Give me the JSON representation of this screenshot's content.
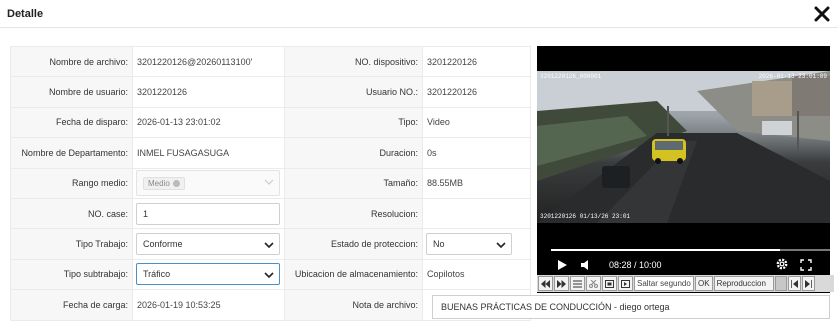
{
  "dialog": {
    "title": "Detalle",
    "close_icon": "close-x-icon"
  },
  "form": {
    "nombre_archivo": {
      "label": "Nombre de archivo:",
      "value": "3201220126@20260113100'"
    },
    "no_dispositivo": {
      "label": "NO. dispositivo:",
      "value": "3201220126"
    },
    "nombre_usuario": {
      "label": "Nombre de usuario:",
      "value": "3201220126"
    },
    "usuario_no": {
      "label": "Usuario NO.:",
      "value": "3201220126"
    },
    "fecha_disparo": {
      "label": "Fecha de disparo:",
      "value": "2026-01-13 23:01:02"
    },
    "tipo": {
      "label": "Tipo:",
      "value": "Video"
    },
    "departamento": {
      "label": "Nombre de Departamento:",
      "value": "INMEL FUSAGASUGA"
    },
    "duracion": {
      "label": "Duracion:",
      "value": "0s"
    },
    "rango_medio": {
      "label": "Rango medio:",
      "tag": "Medio"
    },
    "tamano": {
      "label": "Tamaño:",
      "value": "88.55MB"
    },
    "no_case": {
      "label": "NO. case:",
      "value": "1"
    },
    "resolucion": {
      "label": "Resolucion:",
      "value": ""
    },
    "tipo_trabajo": {
      "label": "Tipo Trabajo:",
      "value": "Conforme"
    },
    "estado_proteccion": {
      "label": "Estado de proteccion:",
      "value": "No"
    },
    "tipo_subtrabajo": {
      "label": "Tipo subtrabajo:",
      "value": "Tráfico"
    },
    "ubicacion": {
      "label": "Ubicacion de almacenamiento:",
      "value": "Copilotos"
    },
    "fecha_carga": {
      "label": "Fecha de carga:",
      "value": "2026-01-19 10:53:25"
    },
    "nota_archivo": {
      "label": "Nota de archivo:",
      "value": "BUENAS PRÁCTICAS DE CONDUCCIÓN - diego ortega"
    }
  },
  "player": {
    "osd_top_left": "3201220126_000001",
    "osd_top_right": "2026-01-13 23:01:09",
    "osd_bottom_left": "3201220126 01/13/26 23:01",
    "time": "08:28 / 10:00",
    "progress": 0.82,
    "icons": [
      "play-icon",
      "volume-icon",
      "settings-gear-icon",
      "fullscreen-icon"
    ]
  },
  "toolbar": {
    "skip_placeholder": "Saltar segundo",
    "ok_label": "OK",
    "playback_label": "Reproduccion",
    "icons": [
      "rewind-icon",
      "fast-forward-icon",
      "list-icon",
      "scissors-icon",
      "snapshot-icon",
      "frame-icon",
      "first-icon",
      "last-icon"
    ]
  },
  "colors": {
    "focus_border": "#4a90c8",
    "label_bg": "#f7f7f7",
    "border": "#ebebeb"
  }
}
